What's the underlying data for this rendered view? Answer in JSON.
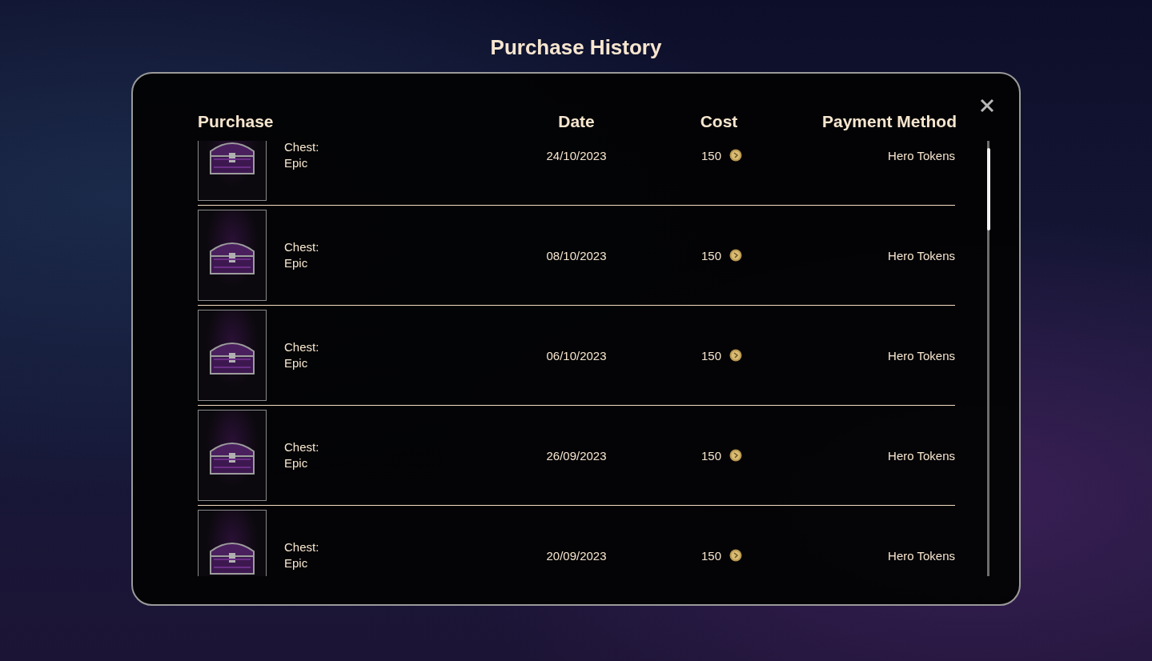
{
  "title": "Purchase History",
  "columns": [
    "Purchase",
    "Date",
    "Cost",
    "Payment Method"
  ],
  "rows": [
    {
      "name": "Chest: Epic",
      "date": "24/10/2023",
      "cost": "150",
      "payment": "Hero Tokens"
    },
    {
      "name": "Chest: Epic",
      "date": "08/10/2023",
      "cost": "150",
      "payment": "Hero Tokens"
    },
    {
      "name": "Chest: Epic",
      "date": "06/10/2023",
      "cost": "150",
      "payment": "Hero Tokens"
    },
    {
      "name": "Chest: Epic",
      "date": "26/09/2023",
      "cost": "150",
      "payment": "Hero Tokens"
    },
    {
      "name": "Chest: Epic",
      "date": "20/09/2023",
      "cost": "150",
      "payment": "Hero Tokens"
    }
  ]
}
